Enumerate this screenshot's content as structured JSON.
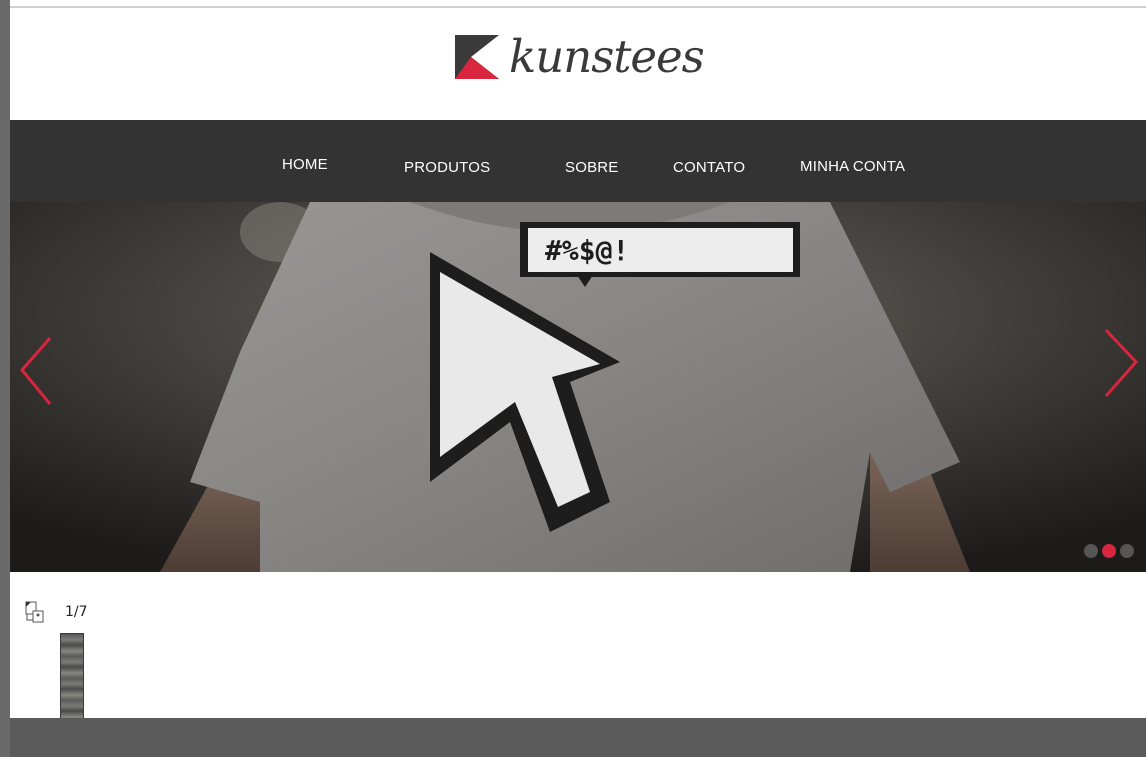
{
  "brand": {
    "name": "kunstees",
    "logo_icon": "k-square-logo-icon",
    "logo_color_dark": "#3a3a3a",
    "logo_color_red": "#d7263d"
  },
  "nav": {
    "items": [
      {
        "label": "HOME"
      },
      {
        "label": "PRODUTOS"
      },
      {
        "label": "SOBRE"
      },
      {
        "label": "CONTATO"
      },
      {
        "label": "MINHA CONTA"
      }
    ]
  },
  "slider": {
    "prev_icon": "chevron-left-icon",
    "next_icon": "chevron-right-icon",
    "arrow_color": "#d7263d",
    "slide_count": 3,
    "active_index": 1
  },
  "gallery": {
    "counter": "1/7",
    "broken_image_icon": "broken-image-icon"
  }
}
